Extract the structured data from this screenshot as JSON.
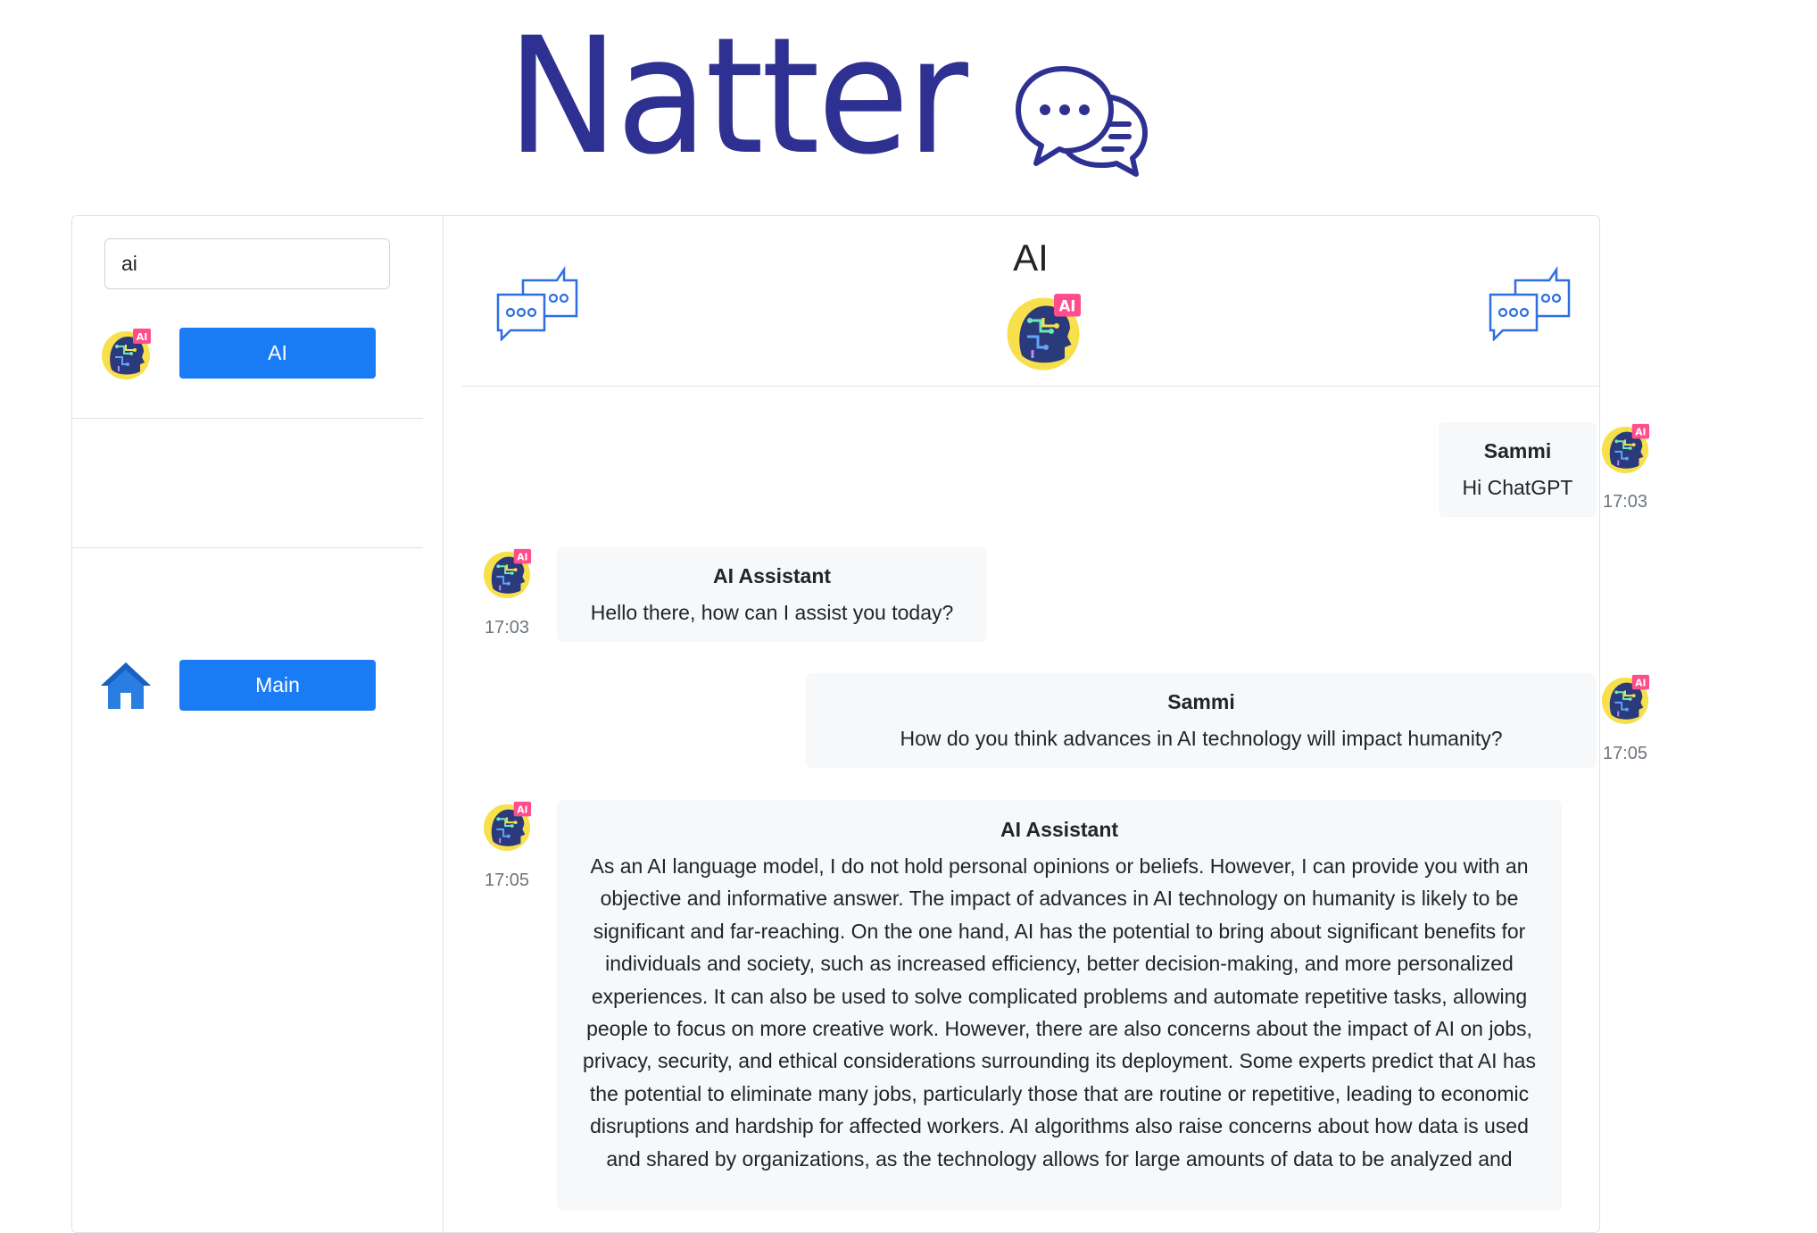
{
  "brand": {
    "name": "Natter"
  },
  "sidebar": {
    "search": {
      "value": "ai"
    },
    "items": [
      {
        "label": "AI",
        "icon": "ai-brain-avatar-icon"
      },
      {
        "label": "Main",
        "icon": "home-icon"
      }
    ]
  },
  "chat": {
    "title": "AI",
    "messages": [
      {
        "author": "Sammi",
        "text": "Hi ChatGPT",
        "time": "17:03",
        "side": "right"
      },
      {
        "author": "AI Assistant",
        "text": "Hello there, how can I assist you today?",
        "time": "17:03",
        "side": "left"
      },
      {
        "author": "Sammi",
        "text": "How do you think advances in AI technology will impact humanity?",
        "time": "17:05",
        "side": "right"
      },
      {
        "author": "AI Assistant",
        "text": "As an AI language model, I do not hold personal opinions or beliefs. However, I can provide you with an objective and informative answer. The impact of advances in AI technology on humanity is likely to be significant and far-reaching. On the one hand, AI has the potential to bring about significant benefits for individuals and society, such as increased efficiency, better decision-making, and more personalized experiences. It can also be used to solve complicated problems and automate repetitive tasks, allowing people to focus on more creative work. However, there are also concerns about the impact of AI on jobs, privacy, security, and ethical considerations surrounding its deployment. Some experts predict that AI has the potential to eliminate many jobs, particularly those that are routine or repetitive, leading to economic disruptions and hardship for affected workers. AI algorithms also raise concerns about how data is used and shared by organizations, as the technology allows for large amounts of data to be analyzed and",
        "time": "17:05",
        "side": "left"
      }
    ]
  },
  "colors": {
    "brand": "#2e3192",
    "button": "#1a7cf5",
    "bubble_bg": "#f7f8fa",
    "avatar_ring": "#f7e04b",
    "avatar_face": "#2b3a7a",
    "avatar_badge": "#ff4d8d"
  }
}
